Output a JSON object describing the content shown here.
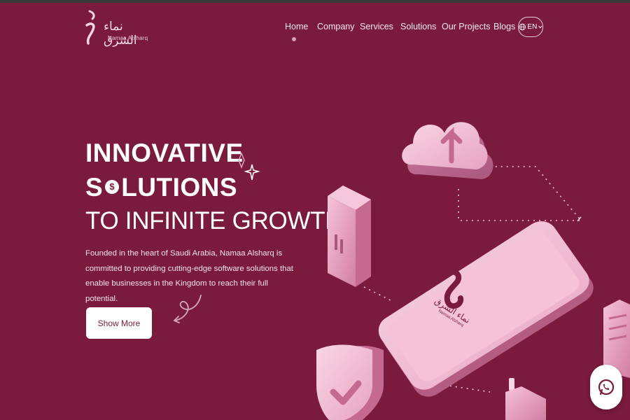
{
  "brand": {
    "name_ar": "نماء الشرق",
    "name_en": "Namaa Alsharq"
  },
  "nav": {
    "items": [
      "Home",
      "Company",
      "Services",
      "Solutions",
      "Our Projects",
      "Blogs"
    ],
    "active": "Home",
    "lang_label": "EN"
  },
  "hero": {
    "line1": "INNOVATIVE",
    "line2_pre": "S",
    "line2_post": "LUTIONS",
    "line3": "TO INFINITE GROWTH",
    "description": "Founded in the heart of Saudi Arabia, Namaa Alsharq is committed to providing cutting-edge software solutions that enable businesses in the Kingdom to reach their full potential.",
    "cta_label": "Show More"
  },
  "phone_screen": {
    "brand_ar": "نماء الشرق",
    "brand_en": "Namaa Alsharq"
  },
  "colors": {
    "background": "#7a1a3c",
    "accent_pink": "#e8a6c3",
    "button_bg": "#ffffff"
  },
  "icons": {
    "lang": "globe-icon",
    "chevron": "chevron-down-icon",
    "whatsapp": "whatsapp-icon"
  }
}
